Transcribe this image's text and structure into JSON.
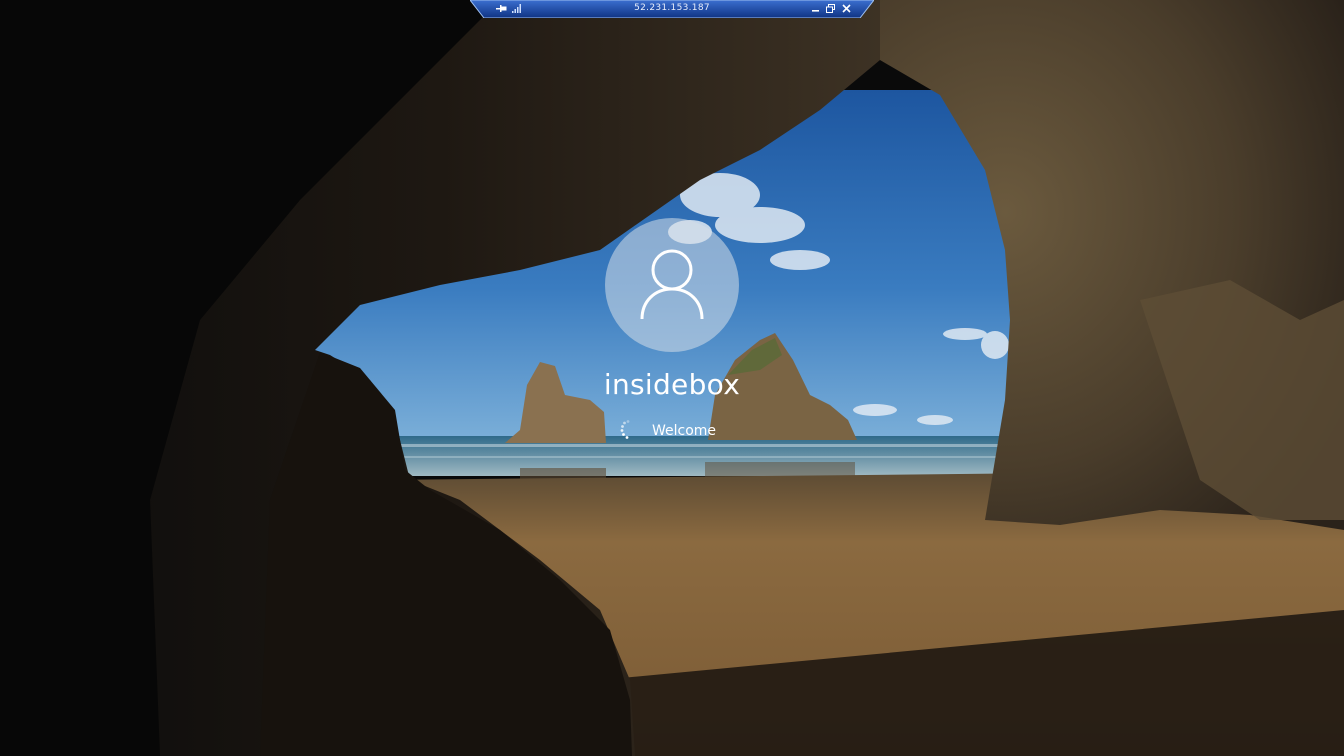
{
  "rdp_bar": {
    "host": "52.231.153.187",
    "icons": [
      "pin-icon",
      "signal-bars-icon",
      "minimize-icon",
      "restore-icon",
      "close-icon"
    ],
    "accent": "#1f4ea3"
  },
  "login": {
    "username": "insidebox",
    "status": "Welcome",
    "avatar_icon": "user-silhouette-icon",
    "spinner_icon": "loading-spinner-icon"
  },
  "colors": {
    "text": "#ffffff",
    "sky": "#2f6fae",
    "sand": "#8a6a3e",
    "rock": "#3b3025"
  }
}
